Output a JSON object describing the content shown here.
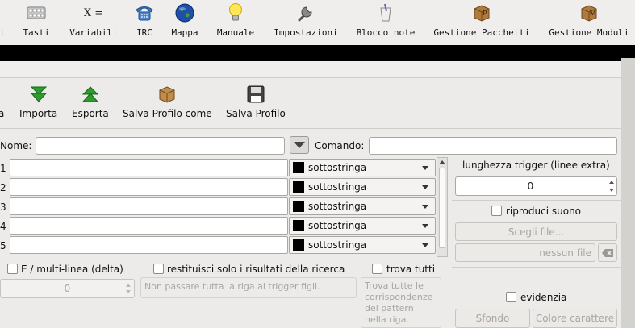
{
  "toolbar": {
    "items": [
      {
        "label": "t",
        "icon": "cut-off-icon"
      },
      {
        "label": "Tasti",
        "icon": "keyboard-icon"
      },
      {
        "label": "Variabili",
        "icon": "variables-icon"
      },
      {
        "label": "IRC",
        "icon": "telephone-icon"
      },
      {
        "label": "Mappa",
        "icon": "globe-icon"
      },
      {
        "label": "Manuale",
        "icon": "lightbulb-icon"
      },
      {
        "label": "Impostazioni",
        "icon": "wrench-icon"
      },
      {
        "label": "Blocco note",
        "icon": "notepad-icon"
      },
      {
        "label": "Gestione Pacchetti",
        "icon": "package-icon"
      },
      {
        "label": "Gestione Moduli",
        "icon": "module-icon"
      }
    ]
  },
  "icons": {
    "variables_glyph": "X ="
  },
  "actions": {
    "partial": "a",
    "import": "Importa",
    "export": "Esporta",
    "save_as": "Salva Profilo come",
    "save": "Salva Profilo"
  },
  "form": {
    "name_label": "Nome:",
    "name_value": "",
    "command_label": "Comando:",
    "command_value": ""
  },
  "patterns": [
    {
      "num": "1",
      "value": "",
      "type": "sottostringa"
    },
    {
      "num": "2",
      "value": "",
      "type": "sottostringa"
    },
    {
      "num": "3",
      "value": "",
      "type": "sottostringa"
    },
    {
      "num": "4",
      "value": "",
      "type": "sottostringa"
    },
    {
      "num": "5",
      "value": "",
      "type": "sottostringa"
    }
  ],
  "right": {
    "trigger_length_label": "lunghezza trigger (linee extra)",
    "trigger_length_value": "0",
    "play_sound_label": "riproduci suono",
    "choose_file_label": "Scegli file...",
    "no_file_placeholder": "nessun file",
    "highlight_label": "evidenzia",
    "background_label": "Sfondo",
    "foreground_label": "Colore carattere"
  },
  "options": {
    "multiline_label": "E / multi-linea (delta)",
    "multiline_value": "0",
    "filter_label": "restituisci solo i risultati della ricerca",
    "filter_placeholder": "Non passare tutta la riga ai trigger figli.",
    "match_all_label": "trova tutti",
    "match_all_placeholder": "Trova tutte le corrispondenze del pattern nella riga."
  },
  "colors": {
    "swatch": "#000000",
    "import_arrow": "#2c9c2c",
    "export_arrow": "#2c9c2c"
  }
}
